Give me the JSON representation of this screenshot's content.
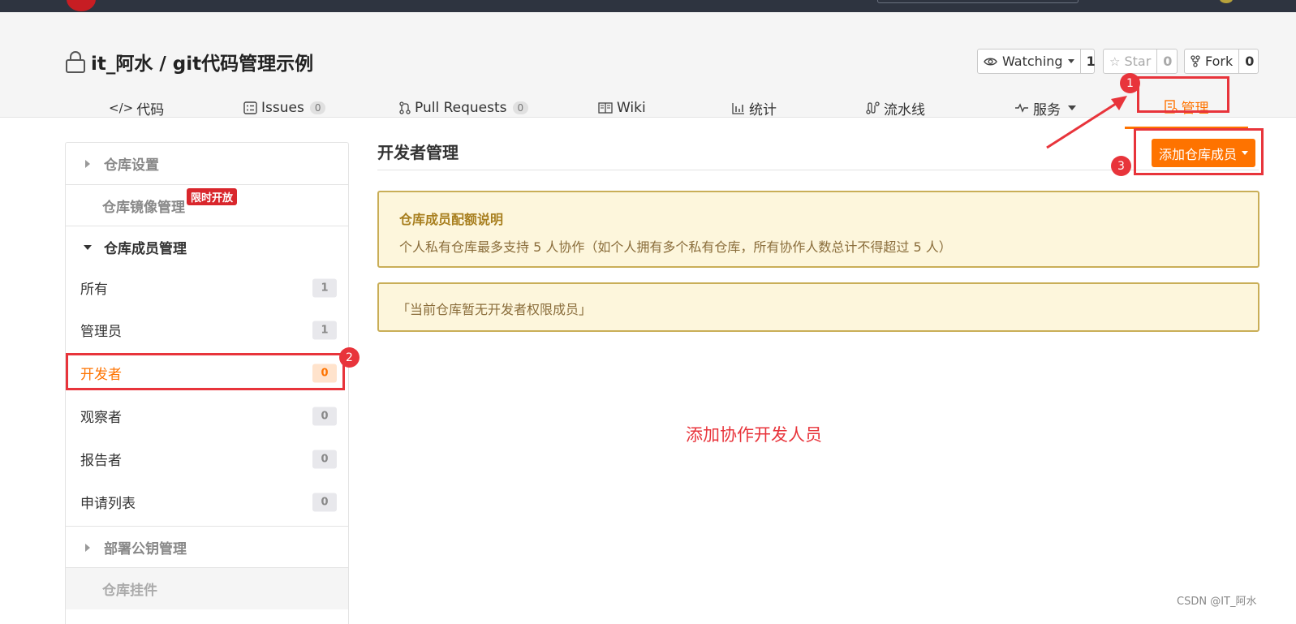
{
  "project": {
    "title": "it_阿水 / git代码管理示例",
    "watch_label": "Watching",
    "watch_count": "1",
    "star_label": "Star",
    "star_count": "0",
    "fork_label": "Fork",
    "fork_count": "0"
  },
  "tabs": [
    {
      "label": "代码",
      "icon": "code-icon"
    },
    {
      "label": "Issues",
      "badge": "0",
      "icon": "issues-icon"
    },
    {
      "label": "Pull Requests",
      "badge": "0",
      "icon": "pull-request-icon"
    },
    {
      "label": "Wiki",
      "icon": "book-icon"
    },
    {
      "label": "统计",
      "icon": "bar-chart-icon"
    },
    {
      "label": "流水线",
      "icon": "pipeline-icon"
    },
    {
      "label": "服务",
      "icon": "pulse-icon"
    },
    {
      "label": "管理",
      "icon": "manage-icon",
      "active": true
    }
  ],
  "sidebar": {
    "repo_settings": "仓库设置",
    "mirror_manage": "仓库镜像管理",
    "limited_badge": "限时开放",
    "member_manage": "仓库成员管理",
    "items": [
      {
        "label": "所有",
        "count": "1"
      },
      {
        "label": "管理员",
        "count": "1"
      },
      {
        "label": "开发者",
        "count": "0",
        "active": true
      },
      {
        "label": "观察者",
        "count": "0"
      },
      {
        "label": "报告者",
        "count": "0"
      },
      {
        "label": "申请列表",
        "count": "0"
      }
    ],
    "deploy_keys": "部署公钥管理",
    "hooks": "仓库挂件"
  },
  "main": {
    "title": "开发者管理",
    "add_member_label": "添加仓库成员",
    "quota_title": "仓库成员配额说明",
    "quota_text": "个人私有仓库最多支持 5 人协作（如个人拥有多个私有仓库，所有协作人数总计不得超过 5 人）",
    "empty_text": "「当前仓库暂无开发者权限成员」"
  },
  "annotations": {
    "caption": "添加协作开发人员",
    "num1": "1",
    "num2": "2",
    "num3": "3",
    "color": "#e8343b"
  },
  "watermark": "CSDN @IT_阿水",
  "colors": {
    "accent": "#fe7300",
    "topbar": "#2e3440",
    "notice_bg": "#fdf6dc"
  }
}
